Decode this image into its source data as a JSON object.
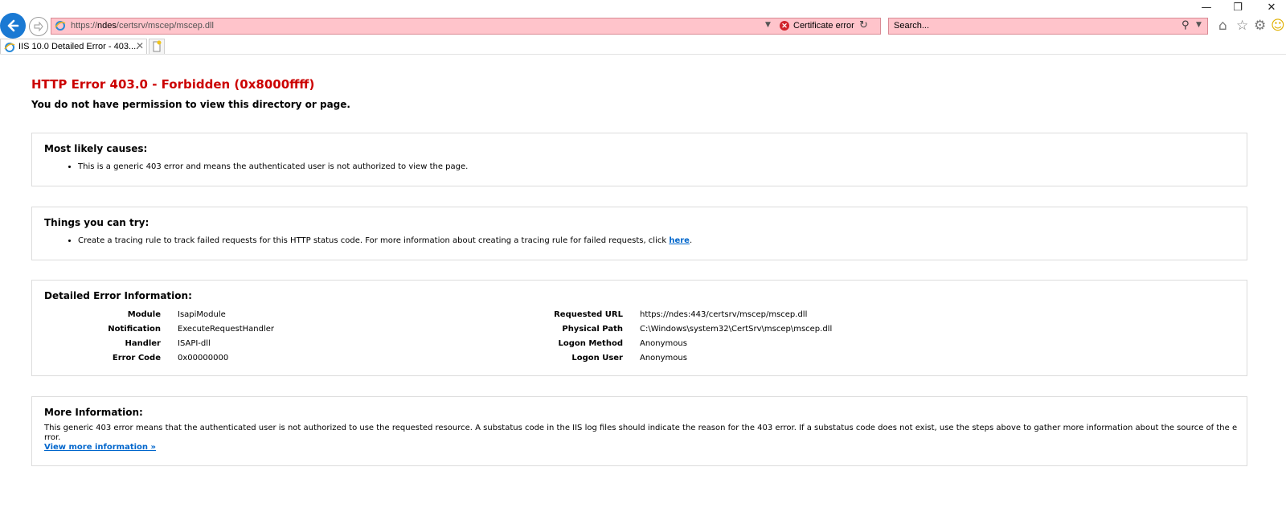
{
  "browser": {
    "address": {
      "scheme": "https://",
      "host": "ndes",
      "path": "/certsrv/mscep/mscep.dll"
    },
    "cert_error_label": "Certificate error",
    "search_placeholder": "Search...",
    "tab_title": "IIS 10.0 Detailed Error - 403....",
    "window_controls": {
      "minimize": "—",
      "restore": "❐",
      "close": "✕"
    }
  },
  "page": {
    "title": "HTTP Error 403.0 - Forbidden (0x8000ffff)",
    "subtitle": "You do not have permission to view this directory or page.",
    "causes": {
      "heading": "Most likely causes:",
      "items": [
        "This is a generic 403 error and means the authenticated user is not authorized to view the page."
      ]
    },
    "try": {
      "heading": "Things you can try:",
      "item_text": "Create a tracing rule to track failed requests for this HTTP status code. For more information about creating a tracing rule for failed requests, click ",
      "link": "here",
      "item_tail": "."
    },
    "details": {
      "heading": "Detailed Error Information:",
      "left": [
        {
          "label": "Module",
          "value": "IsapiModule"
        },
        {
          "label": "Notification",
          "value": "ExecuteRequestHandler"
        },
        {
          "label": "Handler",
          "value": "ISAPI-dll"
        },
        {
          "label": "Error Code",
          "value": "0x00000000"
        }
      ],
      "right": [
        {
          "label": "Requested URL",
          "value": "https://ndes:443/certsrv/mscep/mscep.dll"
        },
        {
          "label": "Physical Path",
          "value": "C:\\Windows\\system32\\CertSrv\\mscep\\mscep.dll"
        },
        {
          "label": "Logon Method",
          "value": "Anonymous"
        },
        {
          "label": "Logon User",
          "value": "Anonymous"
        }
      ]
    },
    "more": {
      "heading": "More Information:",
      "text": "This generic 403 error means that the authenticated user is not authorized to use the requested resource. A substatus code in the IIS log files should indicate the reason for the 403 error. If a substatus code does not exist, use the steps above to gather more information about the source of the error.",
      "link": "View more information »"
    }
  }
}
